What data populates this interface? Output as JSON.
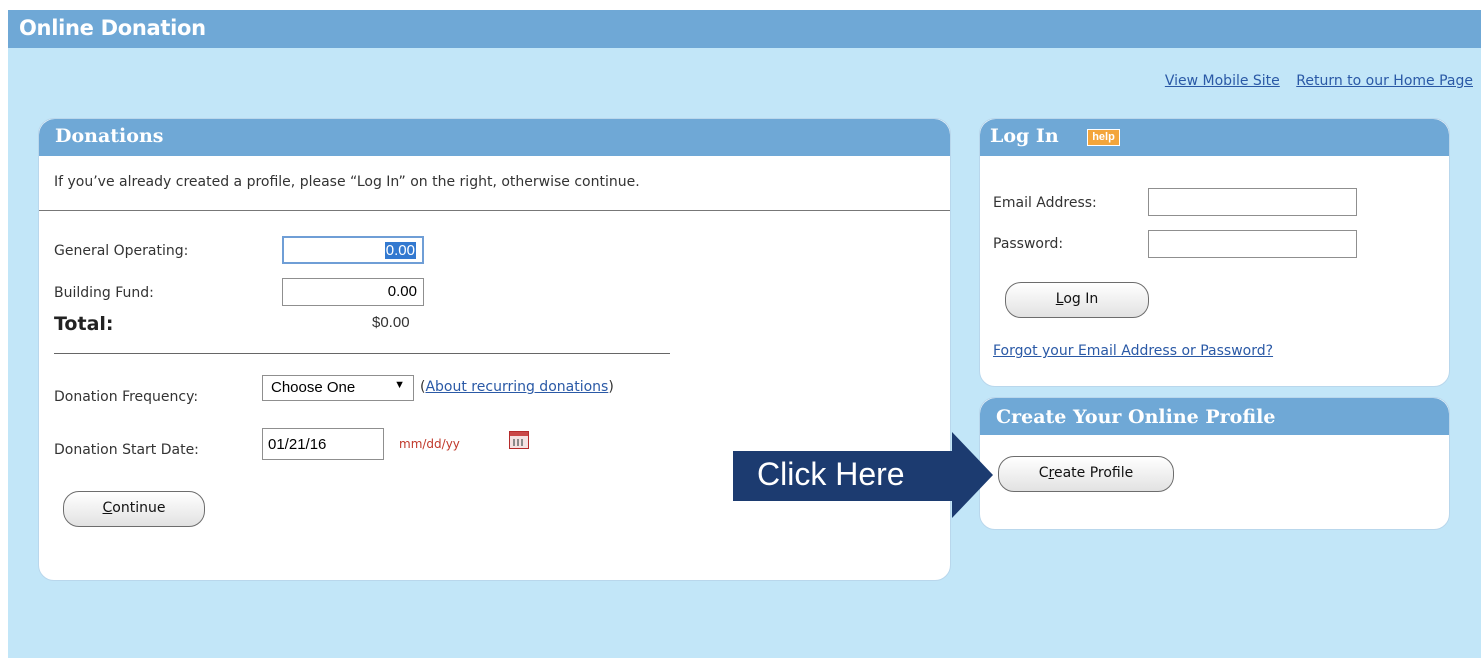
{
  "header": {
    "title": "Online Donation"
  },
  "top_links": {
    "mobile": "View Mobile Site",
    "home": "Return to our Home Page"
  },
  "donations": {
    "title": "Donations",
    "intro": "If you’ve already created a profile, please “Log In” on the right, otherwise continue.",
    "general_operating_label": "General Operating:",
    "general_operating_value": "0.00",
    "building_fund_label": "Building Fund:",
    "building_fund_value": "0.00",
    "total_label": "Total:",
    "total_value": "$0.00",
    "frequency_label": "Donation Frequency:",
    "frequency_value": "Choose One",
    "recurring_link": "About recurring donations",
    "start_date_label": "Donation Start Date:",
    "start_date_value": "01/21/16",
    "date_format": "mm/dd/yy",
    "continue_first_letter": "C",
    "continue_rest": "ontinue"
  },
  "login": {
    "title": "Log In",
    "help": "help",
    "email_label": "Email Address:",
    "password_label": "Password:",
    "button_first_letter": "L",
    "button_rest": "og In",
    "forgot_link": "Forgot your Email Address or Password?"
  },
  "profile": {
    "title": "Create Your Online Profile",
    "button_before": "C",
    "button_underlined": "r",
    "button_after": "eate Profile"
  },
  "callout": {
    "text": "Click Here"
  },
  "colors": {
    "page_bg": "#c2e6f8",
    "header_bg": "#6fa8d6",
    "link": "#2a59a6",
    "callout": "#1c3b70",
    "help_badge": "#f3a53b"
  }
}
